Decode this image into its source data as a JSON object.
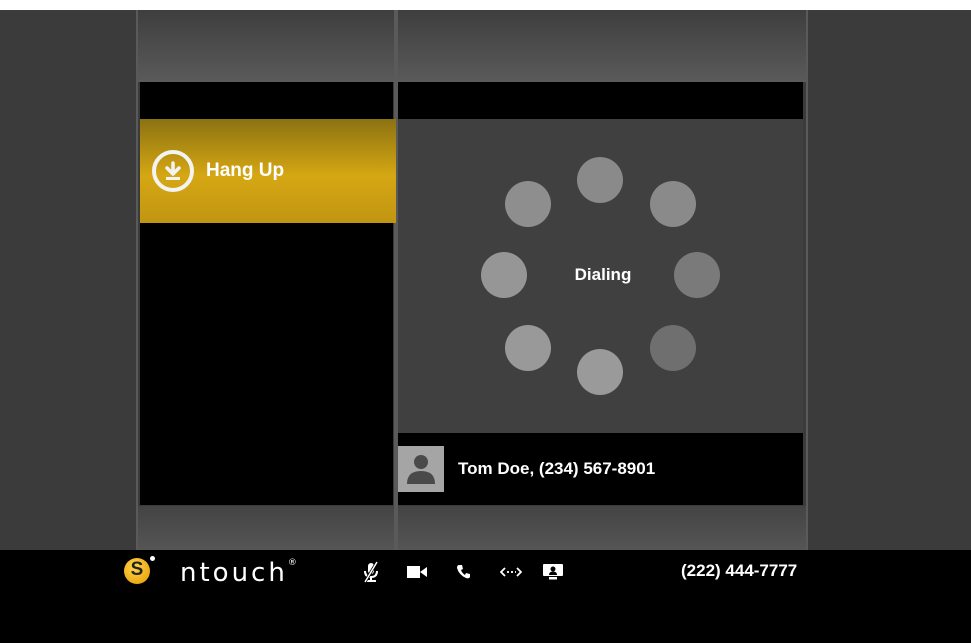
{
  "call": {
    "hangup_label": "Hang Up",
    "status": "Dialing",
    "contact": "Tom Doe, (234) 567-8901"
  },
  "footer": {
    "brand": "ntouch",
    "brand_mark": "®",
    "logo_letter": "S",
    "phone_number": "(222) 444-7777",
    "icons": [
      "mic-muted-icon",
      "video-camera-icon",
      "phone-icon",
      "transfer-icon",
      "screen-share-icon"
    ]
  },
  "colors": {
    "accent": "#d6a713",
    "background": "#3b3b3b",
    "spinner": "#8a8a8a"
  }
}
